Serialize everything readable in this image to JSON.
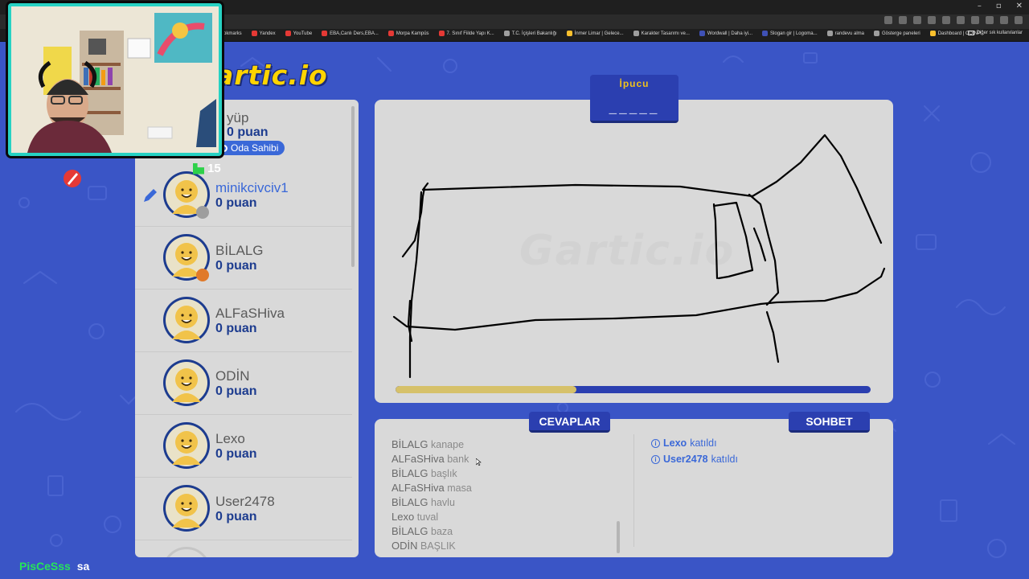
{
  "browser": {
    "bookmarks": [
      {
        "label": "okmarks",
        "color": "#8a8a8a"
      },
      {
        "label": "Yandex",
        "color": "#e53935"
      },
      {
        "label": "YouTube",
        "color": "#e53935"
      },
      {
        "label": "EBA,Canlı Ders,EBA...",
        "color": "#e53935"
      },
      {
        "label": "Morpa Kampüs",
        "color": "#e53935"
      },
      {
        "label": "7. Sınıf Fiilde Yapı K...",
        "color": "#e53935"
      },
      {
        "label": "T.C. İçişleri Bakanlığı",
        "color": "#9e9e9e"
      },
      {
        "label": "İnmer Limar | Gelece...",
        "color": "#fbc02d"
      },
      {
        "label": "Karakter Tasarımı ve...",
        "color": "#9e9e9e"
      },
      {
        "label": "Wordwall | Daha iyi...",
        "color": "#3f51b5"
      },
      {
        "label": "Slogan gir | Logoma...",
        "color": "#3f51b5"
      },
      {
        "label": "randevu alma",
        "color": "#9e9e9e"
      },
      {
        "label": "Gösterge paneleri",
        "color": "#9e9e9e"
      },
      {
        "label": "Dashboard | COINP...",
        "color": "#fbc02d"
      }
    ],
    "other_bookmarks": "Diğer sık kullanılanlar"
  },
  "logo": "artic.io",
  "hint": {
    "title": "İpucu",
    "blanks": "_____"
  },
  "watermark": "Gartic.io",
  "room": {
    "host_badge": "Oda Sahibi",
    "timer": "15",
    "first_player": {
      "name": "yüp",
      "score": "0 puan"
    }
  },
  "players": [
    {
      "name": "minikcivciv1",
      "score": "0 puan",
      "active": true,
      "dot": "#9e9e9e"
    },
    {
      "name": "BİLALG",
      "score": "0 puan",
      "active": false,
      "dot": "#e07a2a"
    },
    {
      "name": "ALFaSHiva",
      "score": "0 puan",
      "active": false,
      "dot": ""
    },
    {
      "name": "ODİN",
      "score": "0 puan",
      "active": false,
      "dot": ""
    },
    {
      "name": "Lexo",
      "score": "0 puan",
      "active": false,
      "dot": ""
    },
    {
      "name": "User2478",
      "score": "0 puan",
      "active": false,
      "dot": ""
    }
  ],
  "progress": {
    "fraction": 0.38
  },
  "tabs": {
    "answers": "CEVAPLAR",
    "chat": "SOHBET"
  },
  "answers": [
    {
      "who": "BİLALG",
      "what": "kanape"
    },
    {
      "who": "ALFaSHiva",
      "what": "bank"
    },
    {
      "who": "BİLALG",
      "what": "başlık"
    },
    {
      "who": "ALFaSHiva",
      "what": "masa"
    },
    {
      "who": "BİLALG",
      "what": "havlu"
    },
    {
      "who": "Lexo",
      "what": "tuval"
    },
    {
      "who": "BİLALG",
      "what": "baza"
    },
    {
      "who": "ODİN",
      "what": "BAŞLIK"
    }
  ],
  "chat": [
    {
      "who": "Lexo",
      "what": "katıldı"
    },
    {
      "who": "User2478",
      "what": "katıldı"
    }
  ],
  "stream_chat": {
    "user": "PisCeSss",
    "message": "sa"
  },
  "colors": {
    "background": "#3a55c6",
    "accent": "#2b3fb0",
    "webcam_border": "#27d2c3"
  }
}
